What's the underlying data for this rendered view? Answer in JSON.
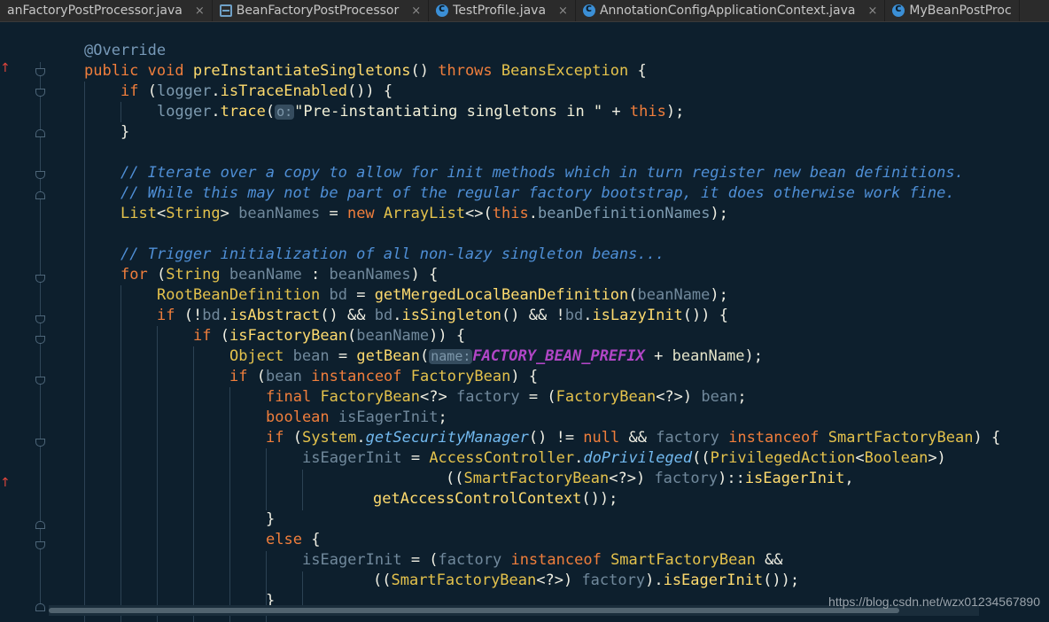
{
  "tabs": [
    {
      "label": "anFactoryPostProcessor.java",
      "icon": "none",
      "close": "×"
    },
    {
      "label": "BeanFactoryPostProcessor",
      "icon": "interface-icon",
      "close": "×"
    },
    {
      "label": "TestProfile.java",
      "icon": "class-icon",
      "close": "×"
    },
    {
      "label": "AnnotationConfigApplicationContext.java",
      "icon": "class-icon",
      "close": "×"
    },
    {
      "label": "MyBeanPostProc",
      "icon": "class-icon",
      "close": ""
    }
  ],
  "gutter": {
    "arrow": "↑"
  },
  "code": {
    "l01": {
      "annotation": "@Override"
    },
    "l02": {
      "public": "public",
      "void": "void",
      "method": "preInstantiateSingletons",
      "parens": "() ",
      "throws": "throws",
      "exception": "BeansException",
      "brace": " {"
    },
    "l03": {
      "if": "if",
      "open": " (",
      "logger": "logger",
      "dot": ".",
      "call": "isTraceEnabled",
      "close": "()) {"
    },
    "l04": {
      "logger": "logger",
      "dot": ".",
      "call": "trace",
      "open": "(",
      "hint": "o:",
      "string": "\"Pre-instantiating singletons in \"",
      "plus": " + ",
      "this": "this",
      "close": ");"
    },
    "l05": {
      "brace": "}"
    },
    "l06": {
      "comment": "// Iterate over a copy to allow for init methods which in turn register new bean definitions."
    },
    "l07": {
      "comment": "// While this may not be part of the regular factory bootstrap, it does otherwise work fine."
    },
    "l08": {
      "list": "List",
      "lt": "<",
      "string": "String",
      "gt": "> ",
      "var": "beanNames",
      "eq": " = ",
      "new": "new",
      "arraylist": "ArrayList",
      "diamond": "<>(",
      "this": "this",
      "dot": ".",
      "field": "beanDefinitionNames",
      "close": ");"
    },
    "l09": {
      "comment": "// Trigger initialization of all non-lazy singleton beans..."
    },
    "l10": {
      "for": "for",
      "open": " (",
      "string": "String",
      "var": "beanName",
      "colon": " : ",
      "names": "beanNames",
      "close": ") {"
    },
    "l11": {
      "type": "RootBeanDefinition",
      "var": "bd",
      "eq": " = ",
      "call": "getMergedLocalBeanDefinition",
      "open": "(",
      "arg": "beanName",
      "close": ");"
    },
    "l12": {
      "if": "if",
      "open": " (!",
      "bd1": "bd",
      "dot1": ".",
      "call1": "isAbstract",
      "mid1": "() && ",
      "bd2": "bd",
      "dot2": ".",
      "call2": "isSingleton",
      "mid2": "() && !",
      "bd3": "bd",
      "dot3": ".",
      "call3": "isLazyInit",
      "close": "()) {"
    },
    "l13": {
      "if": "if",
      "open": " (",
      "call": "isFactoryBean",
      "open2": "(",
      "arg": "beanName",
      "close": ")) {"
    },
    "l14": {
      "type": "Object",
      "var": "bean",
      "eq": " = ",
      "call": "getBean",
      "open": "(",
      "hint": "name:",
      "const": "FACTORY_BEAN_PREFIX",
      "plus": " + ",
      "arg": "beanName",
      "close": ");"
    },
    "l15": {
      "if": "if",
      "open": " (",
      "var": "bean",
      "instanceof": "instanceof",
      "type": "FactoryBean",
      "close": ") {"
    },
    "l16": {
      "final": "final",
      "type": "FactoryBean",
      "generic": "<?> ",
      "var": "factory",
      "eq": " = (",
      "cast": "FactoryBean",
      "generic2": "<?>) ",
      "val": "bean",
      "semi": ";"
    },
    "l17": {
      "boolean": "boolean",
      "var": "isEagerInit",
      "semi": ";"
    },
    "l18": {
      "if": "if",
      "open": " (",
      "system": "System",
      "dot": ".",
      "call": "getSecurityManager",
      "mid": "() != ",
      "null": "null",
      "and": " && ",
      "var": "factory",
      "instanceof": "instanceof",
      "type": "SmartFactoryBean",
      "close": ") {"
    },
    "l19": {
      "var": "isEagerInit",
      "eq": " = ",
      "ac": "AccessController",
      "dot": ".",
      "call": "doPrivileged",
      "open": "((",
      "pa": "PrivilegedAction",
      "lt": "<",
      "bool": "Boolean",
      "close": ">)"
    },
    "l20": {
      "open": "((",
      "type": "SmartFactoryBean",
      "generic": "<?>) ",
      "var": "factory",
      "ref": ")::",
      "method": "isEagerInit",
      "comma": ","
    },
    "l21": {
      "call": "getAccessControlContext",
      "close": "());"
    },
    "l22": {
      "brace": "}"
    },
    "l23": {
      "else": "else",
      "brace": " {"
    },
    "l24": {
      "var": "isEagerInit",
      "eq": " = (",
      "factory": "factory",
      "instanceof": "instanceof",
      "type": "SmartFactoryBean",
      "and": " &&"
    },
    "l25": {
      "open": "((",
      "type": "SmartFactoryBean",
      "generic": "<?>) ",
      "var": "factory",
      "dot": ").",
      "call": "isEagerInit",
      "close": "());"
    },
    "l26": {
      "brace": "}"
    }
  },
  "watermark": "https://blog.csdn.net/wzx01234567890",
  "colors": {
    "background": "#0d1f2d",
    "keyword": "#f07e3c",
    "type": "#e4c24c",
    "comment": "#4f8fd6",
    "constant": "#b146c6",
    "change-marker": "#e0463c"
  }
}
